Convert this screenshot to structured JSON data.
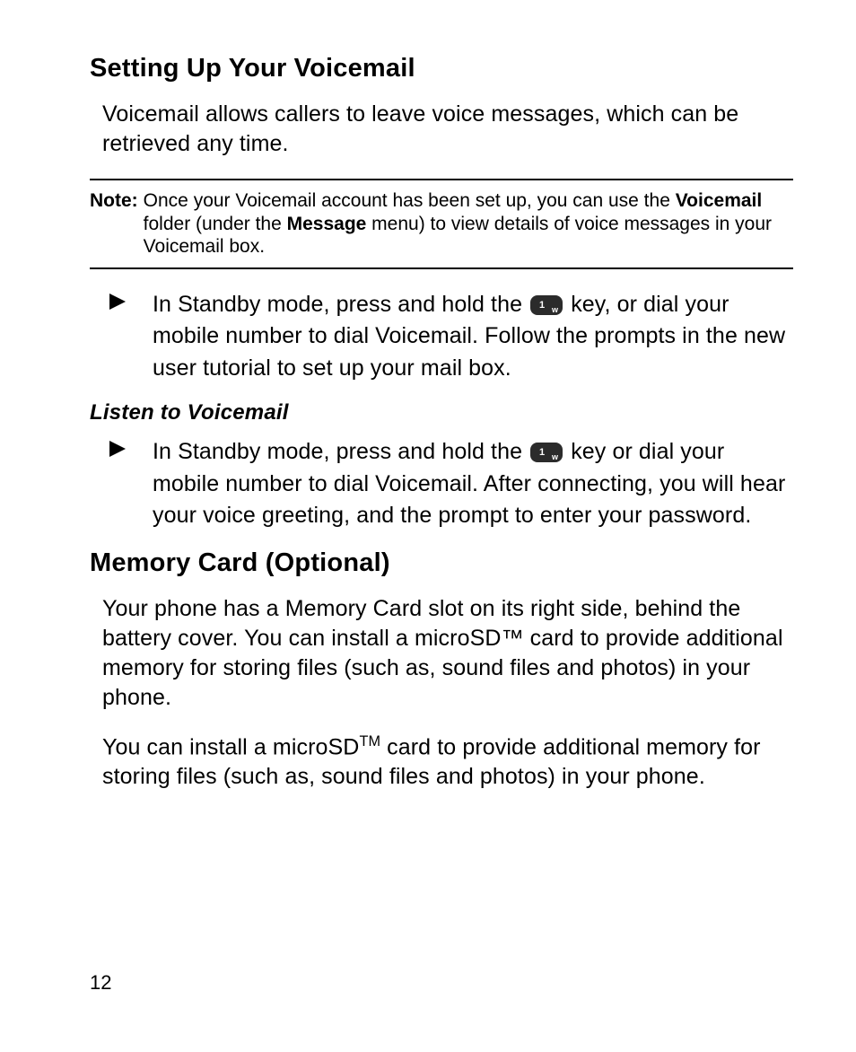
{
  "page_number": "12",
  "section1": {
    "heading": "Setting Up Your Voicemail",
    "intro": "Voicemail allows callers to leave voice messages, which can be retrieved any time.",
    "note": {
      "label": "Note:",
      "before1": "Once your Voicemail account has been set up, you can use the ",
      "bold1": "Voicemail",
      "mid1": " folder (under the ",
      "bold2": "Message",
      "after1": " menu) to view details of voice messages in your Voicemail box."
    },
    "step1": {
      "before_key": "In Standby mode, press and hold the ",
      "after_key": " key, or dial your mobile number to dial Voicemail. Follow the prompts in the new user tutorial to set up your mail box."
    },
    "subheading": "Listen to Voicemail",
    "step2": {
      "before_key": "In Standby mode, press and hold the ",
      "after_key": " key or dial your mobile number to dial Voicemail. After connecting, you will hear your voice greeting, and the prompt to enter your password."
    }
  },
  "section2": {
    "heading": "Memory Card (Optional)",
    "para1": "Your phone has a Memory Card slot on its right side, behind the battery cover. You can install a microSD™ card to provide additional memory for storing files (such as, sound files and photos) in your phone.",
    "para2_before": "You can install a microSD",
    "para2_tm": "TM",
    "para2_after": " card to provide additional memory for storing files (such as, sound files and photos) in your phone."
  },
  "icons": {
    "bullet": "play-triangle-icon",
    "key": "one-w-key-icon"
  }
}
